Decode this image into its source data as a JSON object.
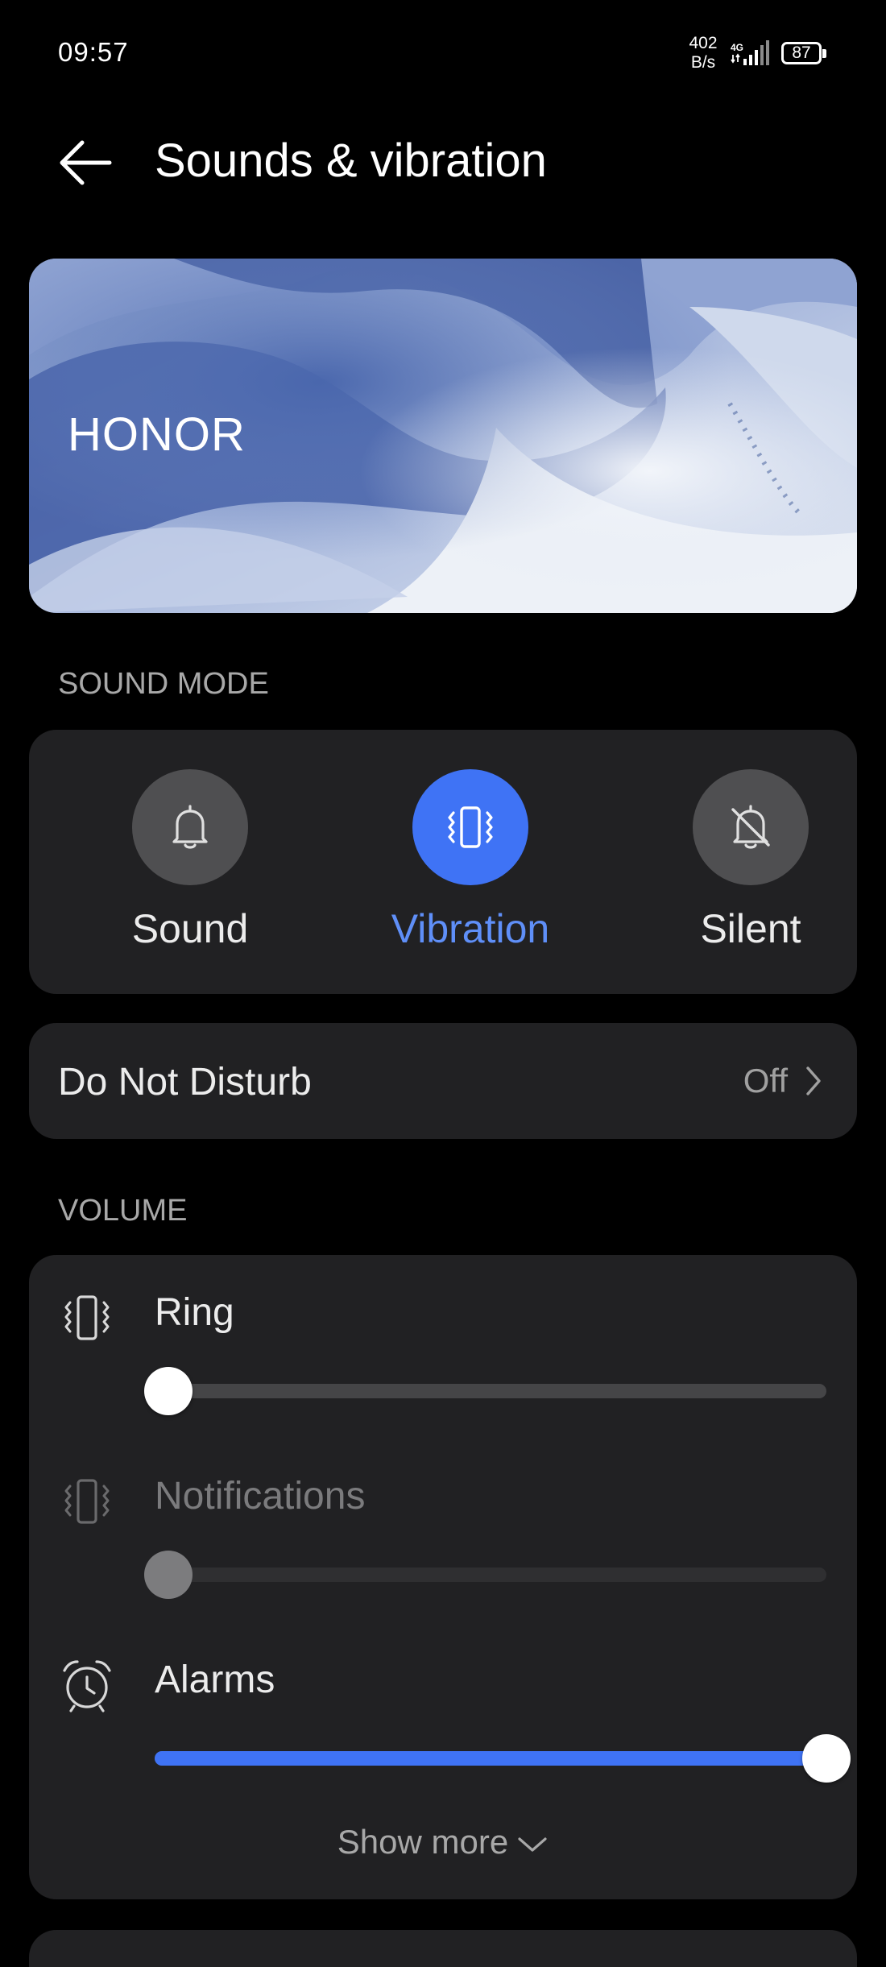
{
  "status_bar": {
    "time": "09:57",
    "net_speed_value": "402",
    "net_speed_unit": "B/s",
    "network_type": "4G",
    "battery_level": "87"
  },
  "header": {
    "title": "Sounds & vibration",
    "back_icon": "back-arrow-icon"
  },
  "banner": {
    "label": "HONOR"
  },
  "sound_mode": {
    "section_label": "SOUND MODE",
    "selected": "Vibration",
    "options": [
      {
        "label": "Sound",
        "icon": "bell-icon",
        "active": false
      },
      {
        "label": "Vibration",
        "icon": "vibration-icon",
        "active": true
      },
      {
        "label": "Silent",
        "icon": "bell-off-icon",
        "active": false
      }
    ]
  },
  "do_not_disturb": {
    "label": "Do Not Disturb",
    "value": "Off"
  },
  "volume": {
    "section_label": "VOLUME",
    "rows": [
      {
        "label": "Ring",
        "icon": "vibration-icon",
        "level": 0.02,
        "enabled": true
      },
      {
        "label": "Notifications",
        "icon": "vibration-icon",
        "level": 0.02,
        "enabled": false
      },
      {
        "label": "Alarms",
        "icon": "alarm-clock-icon",
        "level": 1.0,
        "enabled": true
      }
    ],
    "show_more_label": "Show more"
  },
  "colors": {
    "accent": "#3f73f5",
    "accent_text": "#5f8ff8",
    "card_bg": "#212123",
    "page_bg": "#000000"
  }
}
